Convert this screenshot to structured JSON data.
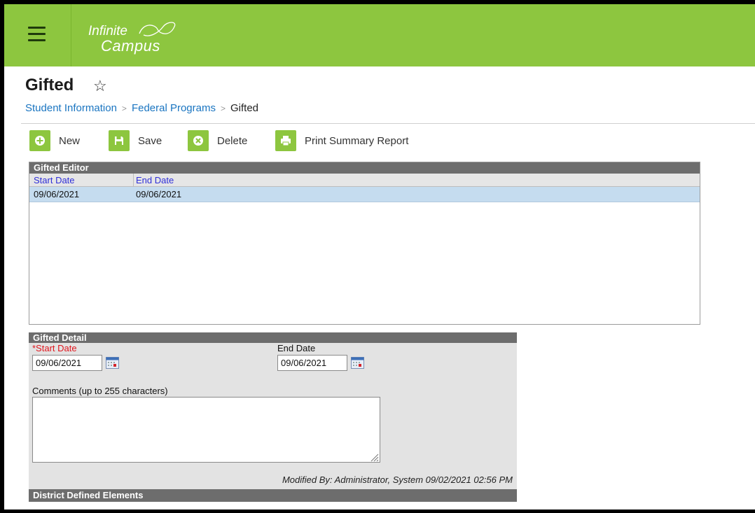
{
  "app": {
    "logo_line1": "Infinite",
    "logo_line2": "Campus"
  },
  "page": {
    "title": "Gifted",
    "favorite_icon": "star-outline-icon"
  },
  "breadcrumb": {
    "items": [
      "Student Information",
      "Federal Programs"
    ],
    "current": "Gifted"
  },
  "toolbar": {
    "new_label": "New",
    "save_label": "Save",
    "delete_label": "Delete",
    "print_label": "Print Summary Report"
  },
  "editor": {
    "title": "Gifted Editor",
    "columns": [
      "Start Date",
      "End Date"
    ],
    "rows": [
      {
        "start_date": "09/06/2021",
        "end_date": "09/06/2021",
        "selected": true
      }
    ]
  },
  "detail": {
    "title": "Gifted Detail",
    "start_date_label": "*Start Date",
    "start_date_value": "09/06/2021",
    "end_date_label": "End Date",
    "end_date_value": "09/06/2021",
    "comments_label": "Comments (up to 255 characters)",
    "comments_value": "",
    "modified_text": "Modified By: Administrator, System 09/02/2021 02:56 PM",
    "district_section": "District Defined Elements"
  },
  "colors": {
    "brand_green": "#8dc63f",
    "panel_header": "#6d6d6d",
    "selected_row": "#c5dcef",
    "link_blue": "#1a75c1",
    "required_red": "#e0161e"
  }
}
